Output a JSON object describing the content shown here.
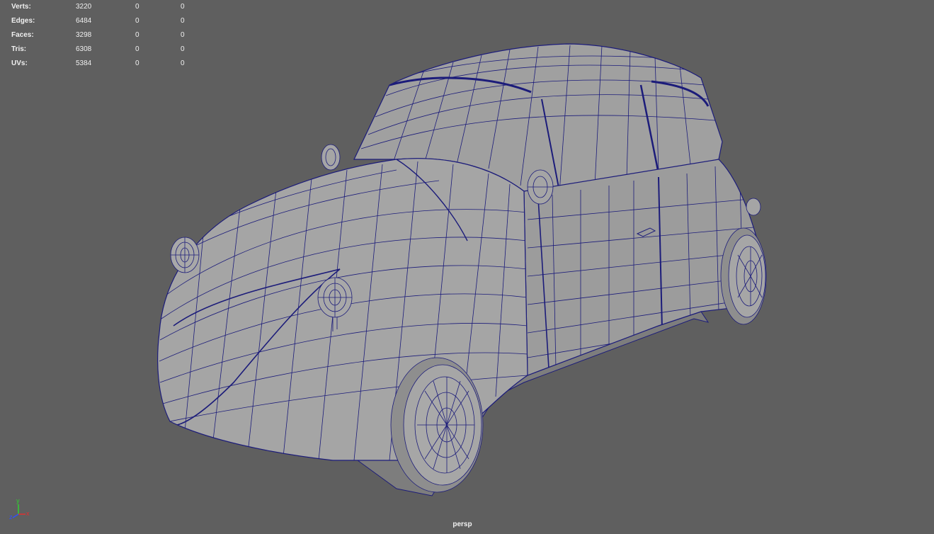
{
  "stats": [
    {
      "label": "Verts:",
      "total": "3220",
      "selected": "0",
      "component": "0"
    },
    {
      "label": "Edges:",
      "total": "6484",
      "selected": "0",
      "component": "0"
    },
    {
      "label": "Faces:",
      "total": "3298",
      "selected": "0",
      "component": "0"
    },
    {
      "label": "Tris:",
      "total": "6308",
      "selected": "0",
      "component": "0"
    },
    {
      "label": "UVs:",
      "total": "5384",
      "selected": "0",
      "component": "0"
    }
  ],
  "camera": "persp",
  "axis": {
    "y": "y",
    "x": "x",
    "z": "z"
  },
  "colors": {
    "background": "#5f5f5f",
    "mesh_fill": "#a3a3a3",
    "wire": "#1c1c7a",
    "axis_x": "#e03030",
    "axis_y": "#30d030",
    "axis_z": "#3050ff"
  }
}
